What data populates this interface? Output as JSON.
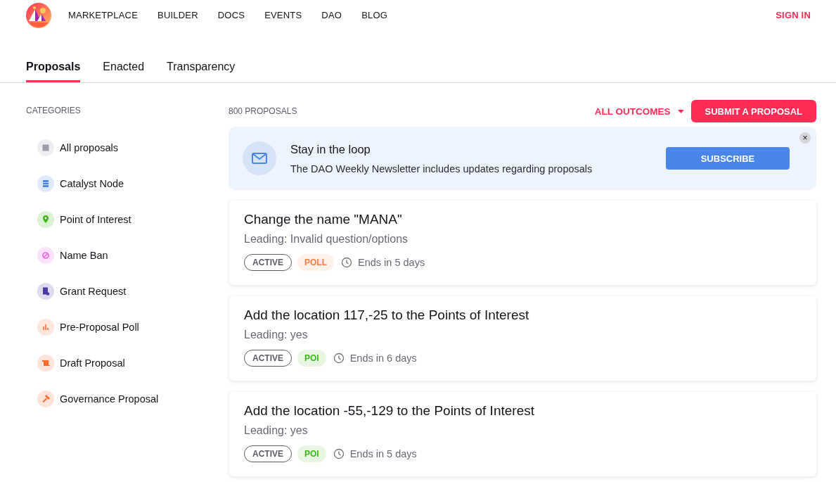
{
  "nav": {
    "links": [
      "MARKETPLACE",
      "BUILDER",
      "DOCS",
      "EVENTS",
      "DAO",
      "BLOG"
    ],
    "sign_in": "SIGN IN"
  },
  "tabs": [
    {
      "label": "Proposals",
      "selected": true
    },
    {
      "label": "Enacted",
      "selected": false
    },
    {
      "label": "Transparency",
      "selected": false
    }
  ],
  "sidebar": {
    "heading": "CATEGORIES",
    "items": [
      {
        "label": "All proposals",
        "kind": "all"
      },
      {
        "label": "Catalyst Node",
        "kind": "catalyst"
      },
      {
        "label": "Point of Interest",
        "kind": "poi"
      },
      {
        "label": "Name Ban",
        "kind": "ban"
      },
      {
        "label": "Grant Request",
        "kind": "grant"
      },
      {
        "label": "Pre-Proposal Poll",
        "kind": "poll"
      },
      {
        "label": "Draft Proposal",
        "kind": "draft"
      },
      {
        "label": "Governance Proposal",
        "kind": "governance"
      }
    ]
  },
  "toolbar": {
    "count": "800 PROPOSALS",
    "filter": "ALL OUTCOMES",
    "submit": "SUBMIT A PROPOSAL"
  },
  "newsletter": {
    "title": "Stay in the loop",
    "text": "The DAO Weekly Newsletter includes updates regarding proposals",
    "button": "SUBSCRIBE",
    "close": "×"
  },
  "proposals": [
    {
      "title": "Change the name \"MANA\"",
      "leading": "Leading: Invalid question/options",
      "status": "ACTIVE",
      "tag": {
        "label": "POLL",
        "kind": "poll"
      },
      "ends": "Ends in 5 days"
    },
    {
      "title": "Add the location 117,-25 to the Points of Interest",
      "leading": "Leading: yes",
      "status": "ACTIVE",
      "tag": {
        "label": "POI",
        "kind": "poi"
      },
      "ends": "Ends in 6 days"
    },
    {
      "title": "Add the location -55,-129 to the Points of Interest",
      "leading": "Leading: yes",
      "status": "ACTIVE",
      "tag": {
        "label": "POI",
        "kind": "poi"
      },
      "ends": "Ends in 5 days"
    }
  ]
}
